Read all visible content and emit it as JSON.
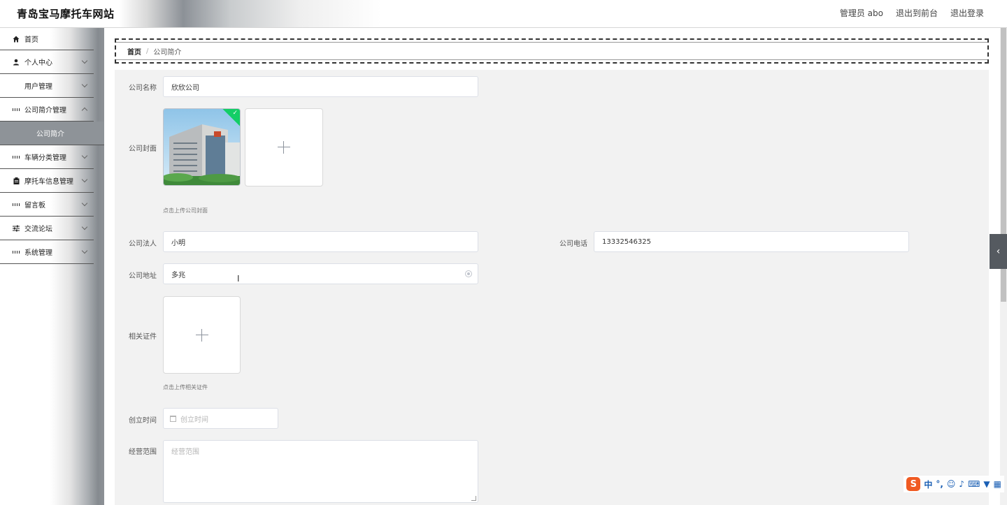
{
  "header": {
    "site_title": "青岛宝马摩托车网站",
    "user_label": "管理员 abo",
    "back_to_front": "退出到前台",
    "logout": "退出登录"
  },
  "sidebar": {
    "items": [
      {
        "label": "首页",
        "icon": "home-icon"
      },
      {
        "label": "个人中心",
        "icon": "user-icon"
      },
      {
        "label": "用户管理",
        "icon": "grid-icon"
      },
      {
        "label": "公司简介管理",
        "icon": "grid-icon"
      },
      {
        "label": "车辆分类管理",
        "icon": "grid-icon"
      },
      {
        "label": "摩托车信息管理",
        "icon": "clipboard-icon"
      },
      {
        "label": "留言板",
        "icon": "grid-icon"
      },
      {
        "label": "交流论坛",
        "icon": "sliders-icon"
      },
      {
        "label": "系统管理",
        "icon": "grid-icon"
      }
    ],
    "active_sub": "公司简介"
  },
  "breadcrumb": {
    "home": "首页",
    "separator": "/",
    "current": "公司简介"
  },
  "form": {
    "company_name_label": "公司名称",
    "company_name_value": "欣欣公司",
    "cover_label": "公司封面",
    "cover_tip": "点击上传公司封面",
    "legal_label": "公司法人",
    "legal_value": "小明",
    "phone_label": "公司电话",
    "phone_value": "13332546325",
    "address_label": "公司地址",
    "address_value": "多兆",
    "cert_label": "相关证件",
    "cert_tip": "点击上传相关证件",
    "founded_label": "创立时间",
    "founded_placeholder": "创立时间",
    "scope_label": "经营范围",
    "scope_placeholder": "经营范围"
  },
  "ime": {
    "logo": "S",
    "mode": "中"
  },
  "colors": {
    "success_badge": "#13ce66",
    "toggle_bg": "#555a60"
  }
}
